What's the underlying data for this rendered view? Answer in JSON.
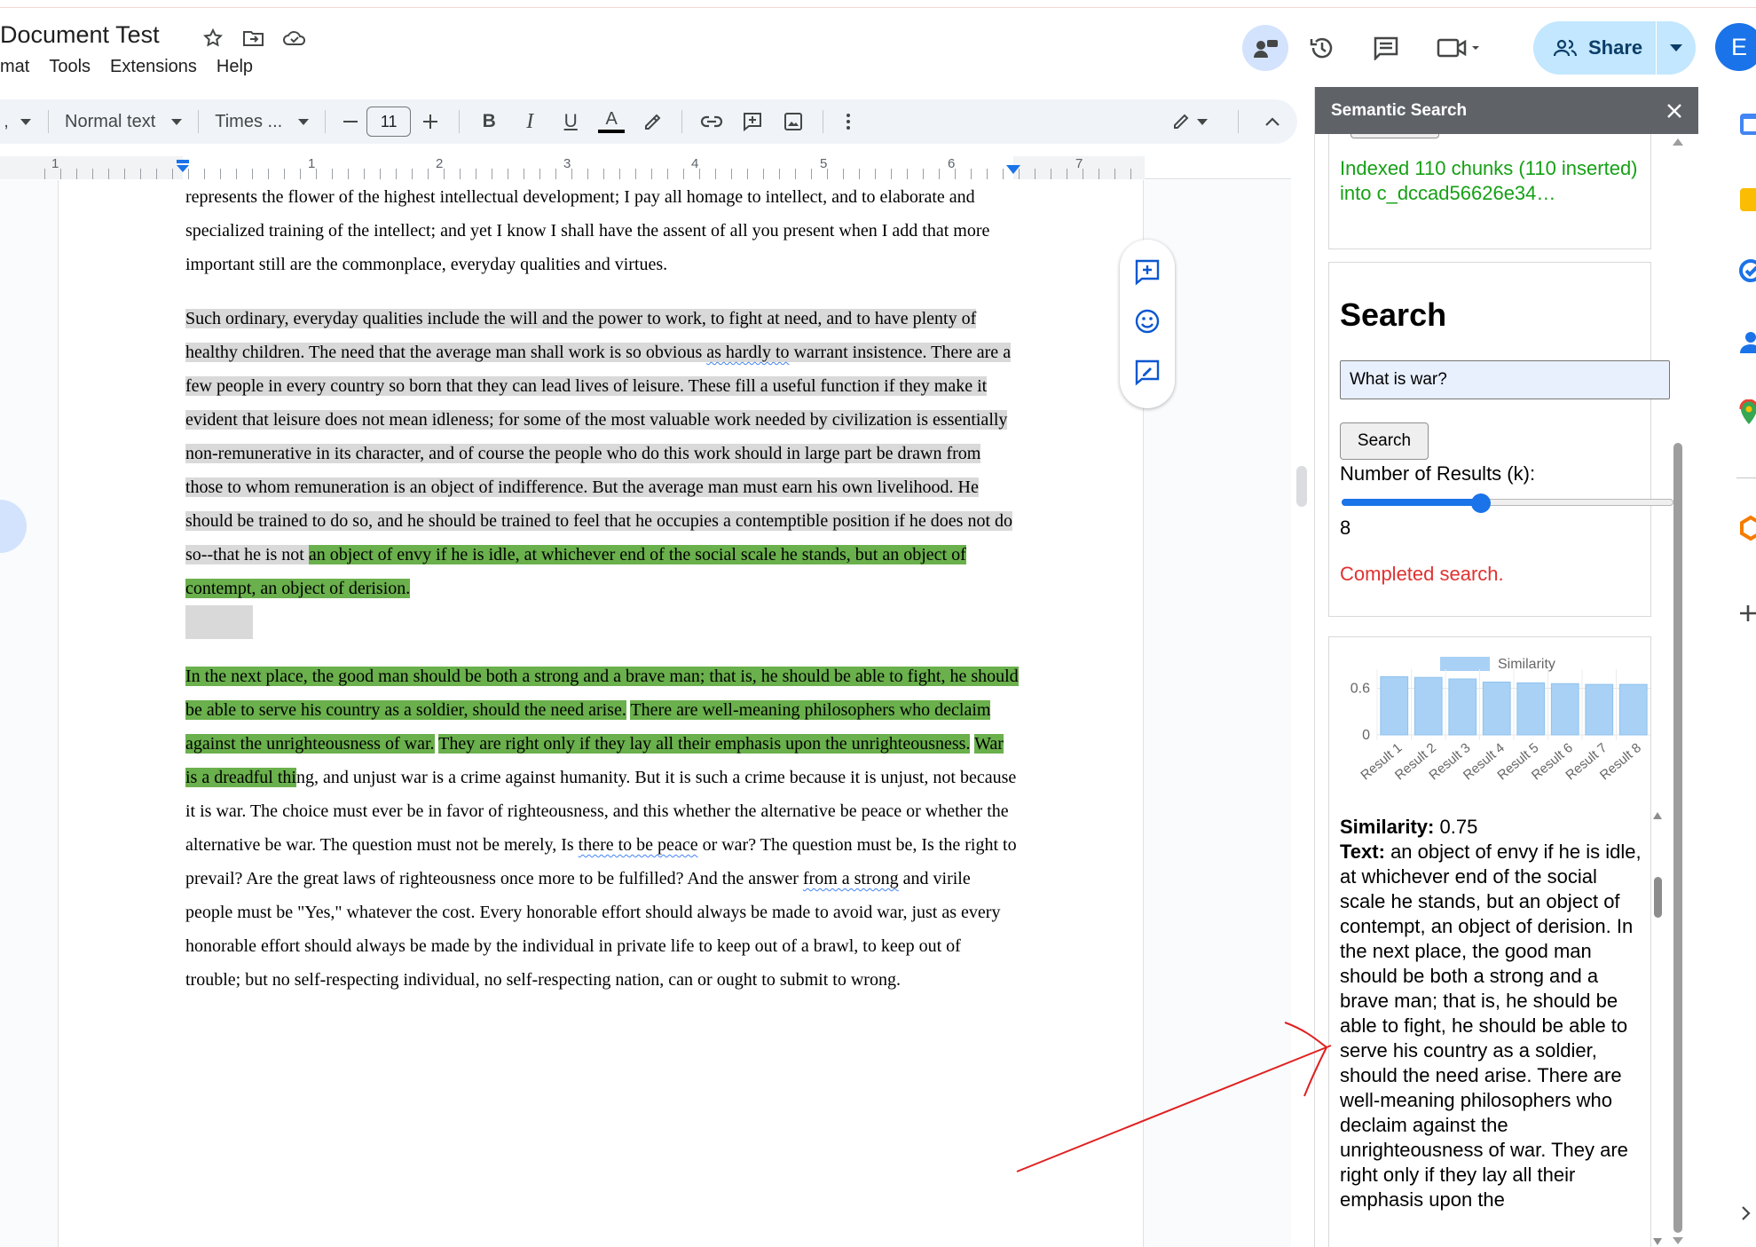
{
  "header": {
    "doc_title": "Document Test",
    "menu": [
      "mat",
      "Tools",
      "Extensions",
      "Help"
    ],
    "share_label": "Share",
    "avatar_letter": "E"
  },
  "toolbar": {
    "style_label": "Normal text",
    "font_label": "Times ...",
    "font_size": "11"
  },
  "ruler": {
    "numbers": [
      "1",
      "1",
      "2",
      "3",
      "4",
      "5",
      "6",
      "7"
    ]
  },
  "document": {
    "p1": "represents the flower of the highest intellectual development; I pay all homage to intellect, and to elaborate and specialized training of the intellect; and yet I know I shall have the assent of all you present when I add that more important still are the commonplace, everyday qualities and virtues.",
    "p2_a": "Such ordinary, everyday qualities include the will and the power to work, to fight at need, and to have plenty of healthy children. The need that the average man shall work is so obvious ",
    "p2_sq": "as hardly to",
    "p2_b": " warrant insistence. There are a few people in every country so born that they can lead lives of leisure. These fill a useful function if they make it evident that leisure does not mean idleness; for some of the most valuable work needed by civilization is essentially non-remunerative in its character, and of course the people who do this work should in large part be drawn from those to whom remuneration is an object of indifference. But the average man must earn his own livelihood. He should be trained to do so, and he should be trained to feel that he occupies a contemptible position if he does not do so--that he is not ",
    "p2_green": "an object of envy if he is idle, at whichever end of the social scale he stands, but an object of contempt, an object of derision.",
    "p3_g1": "In the next place, the good man should be both a strong and a brave man; that is, he should be able to fight, he should be able to serve his country as a soldier, should the need arise.",
    "p3_g2": "There are well-meaning philosophers who declaim against the unrighteousness of war.",
    "p3_g3": "They are right only if they lay all their emphasis upon the unrighteousness.",
    "p3_g4": "War is a dreadful thi",
    "p3_a": "ng, and unjust war is a crime against humanity. But it is such a crime because it is unjust, not because it is war. The choice must ever be in favor of righteousness, and this whether the alternative be peace or whether the alternative be war. The question must not be merely, Is ",
    "p3_sq1": "there to be peace",
    "p3_b": " or war? The question must be, Is the right to prevail? Are the great laws of righteousness once more to be fulfilled? And the answer ",
    "p3_sq2": "from a strong",
    "p3_c": " and virile people must be \"Yes,\" whatever the cost. Every honorable effort should always be made to avoid war, just as every honorable effort should always be made by the individual in private life to keep out of a brawl, to keep out of trouble; but no self-respecting individual, no self-respecting nation, can or ought to submit to wrong."
  },
  "panel": {
    "title": "Semantic Search",
    "index_status": "Indexed 110 chunks (110 inserted) into c_dccad56626e34…",
    "search_heading": "Search",
    "query": "What is war?",
    "search_button": "Search",
    "k_label": "Number of Results (k):",
    "k_value": "8",
    "k": 8,
    "k_fraction": 0.42,
    "search_status": "Completed search.",
    "result": {
      "similarity_label": "Similarity:",
      "similarity_value": "0.75",
      "text_label": "Text:",
      "text": "an object of envy if he is idle, at whichever end of the social scale he stands, but an object of contempt, an object of derision. In the next place, the good man should be both a strong and a brave man; that is, he should be able to fight, he should be able to serve his country as a soldier, should the need arise. There are well-meaning philosophers who declaim against the unrighteousness of war. They are right only if they lay all their emphasis upon the"
    }
  },
  "chart_data": {
    "type": "bar",
    "categories": [
      "Result 1",
      "Result 2",
      "Result 3",
      "Result 4",
      "Result 5",
      "Result 6",
      "Result 7",
      "Result 8"
    ],
    "series": [
      {
        "name": "Similarity",
        "values": [
          0.75,
          0.74,
          0.72,
          0.68,
          0.67,
          0.66,
          0.65,
          0.65
        ]
      }
    ],
    "yticks": [
      "0.6",
      "0"
    ],
    "ylim": [
      0,
      0.8
    ],
    "legend": "top",
    "bar_color": "#a8d1f5",
    "grid": true
  },
  "colors": {
    "highlight_green": "#6ab04c",
    "highlight_gray": "#d9d9d9",
    "share_bg": "#c2e7ff",
    "accent_blue": "#1a73e8",
    "status_green": "#15a015",
    "status_red": "#e03131",
    "annotation_red": "#e02020"
  }
}
